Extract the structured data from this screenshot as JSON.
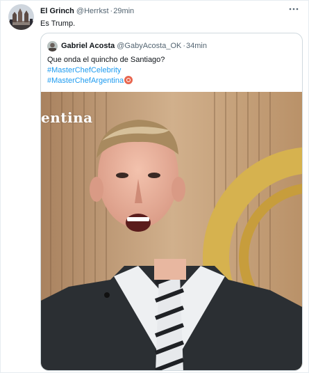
{
  "tweet": {
    "author_name": "El Grinch",
    "author_handle": "@Herrkst",
    "separator": "·",
    "time": "29min",
    "text": "Es Trump.",
    "more_icon": "more-horizontal-icon"
  },
  "quote": {
    "author_name": "Gabriel Acosta",
    "author_handle": "@GabyAcosta_OK",
    "separator": "·",
    "time": "34min",
    "text_line": "Que onda el  quincho de Santiago?",
    "hashtags": [
      "#MasterChefCelebrity",
      "#MasterChefArgentina"
    ],
    "hashtag_icon": "masterchef-logo-icon",
    "media_overlay_text": "entina"
  },
  "colors": {
    "link": "#1d9bf0",
    "secondary_text": "#536471",
    "border": "#cfd9de",
    "jacket": "#2b2f33",
    "background_wood": "#c49a6c"
  }
}
